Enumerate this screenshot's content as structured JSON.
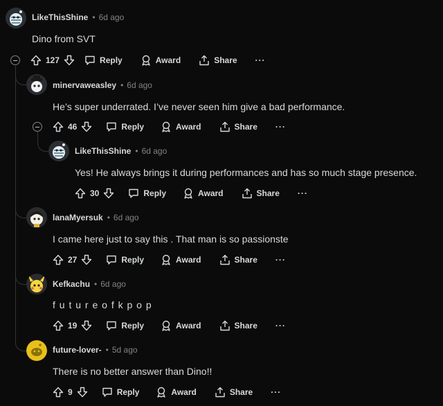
{
  "actions": {
    "reply": "Reply",
    "award": "Award",
    "share": "Share",
    "more": "···"
  },
  "comments": [
    {
      "author": "LikeThisShine",
      "time": "6d ago",
      "text": "Dino from SVT",
      "votes": "127",
      "avatar": "snoo-striped-avatar"
    },
    {
      "author": "minervaweasley",
      "time": "6d ago",
      "text": "He’s super underrated. I’ve never seen him give a bad performance.",
      "votes": "46",
      "avatar": "snoo-hat-avatar"
    },
    {
      "author": "LikeThisShine",
      "time": "6d ago",
      "text": "Yes! He always brings it during performances and has so much stage presence.",
      "votes": "30",
      "avatar": "snoo-striped-avatar"
    },
    {
      "author": "lanaMyersuk",
      "time": "6d ago",
      "text": "I came here just to say this . That man is so passionste",
      "votes": "27",
      "avatar": "snoo-yellow-avatar"
    },
    {
      "author": "Kefkachu",
      "time": "6d ago",
      "text": "f u t u r e o f k p o p",
      "votes": "19",
      "avatar": "snoo-pikachu-avatar"
    },
    {
      "author": "future-lover-",
      "time": "5d ago",
      "text": "There is no better answer than Dino!!",
      "votes": "9",
      "avatar": "snoo-default-yellow-avatar"
    }
  ],
  "colors": {
    "background": "#0b0b0b",
    "text": "#d7dadc",
    "muted": "#818384",
    "thread": "#343536"
  }
}
